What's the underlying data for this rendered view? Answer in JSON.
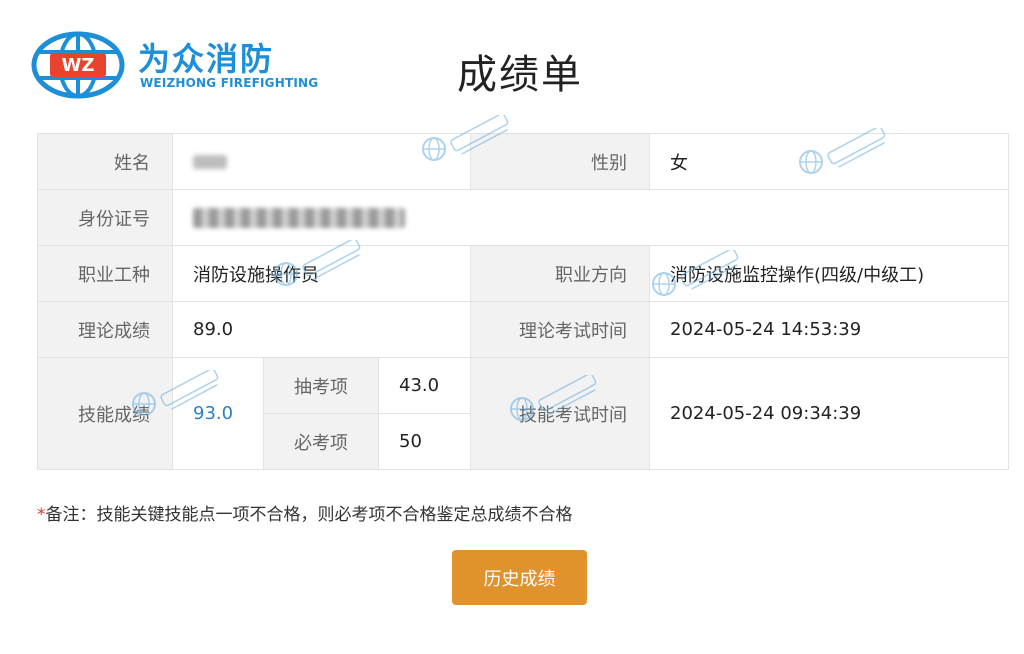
{
  "brand": {
    "logo_badge": "WZ",
    "name_cn": "为众消防",
    "name_en": "WEIZHONG FIREFIGHTING",
    "color": "#1d8ed8"
  },
  "page_title": "成绩单",
  "table": {
    "name_label": "姓名",
    "gender_label": "性别",
    "gender_value": "女",
    "id_label": "身份证号",
    "occupation_label": "职业工种",
    "occupation_value": "消防设施操作员",
    "direction_label": "职业方向",
    "direction_value": "消防设施监控操作(四级/中级工)",
    "theory_score_label": "理论成绩",
    "theory_score_value": "89.0",
    "theory_time_label": "理论考试时间",
    "theory_time_value": "2024-05-24 14:53:39",
    "skill_score_label": "技能成绩",
    "skill_score_value": "93.0",
    "random_item_label": "抽考项",
    "random_item_value": "43.0",
    "required_item_label": "必考项",
    "required_item_value": "50",
    "skill_time_label": "技能考试时间",
    "skill_time_value": "2024-05-24 09:34:39"
  },
  "note": {
    "star": "*",
    "text": "备注：技能关键技能点一项不合格，则必考项不合格鉴定总成绩不合格"
  },
  "history_button_label": "历史成绩",
  "colors": {
    "accent_button": "#e0922c",
    "skill_score": "#2c7fc9",
    "label_bg": "#f2f2f2",
    "note_star": "#e03030"
  }
}
